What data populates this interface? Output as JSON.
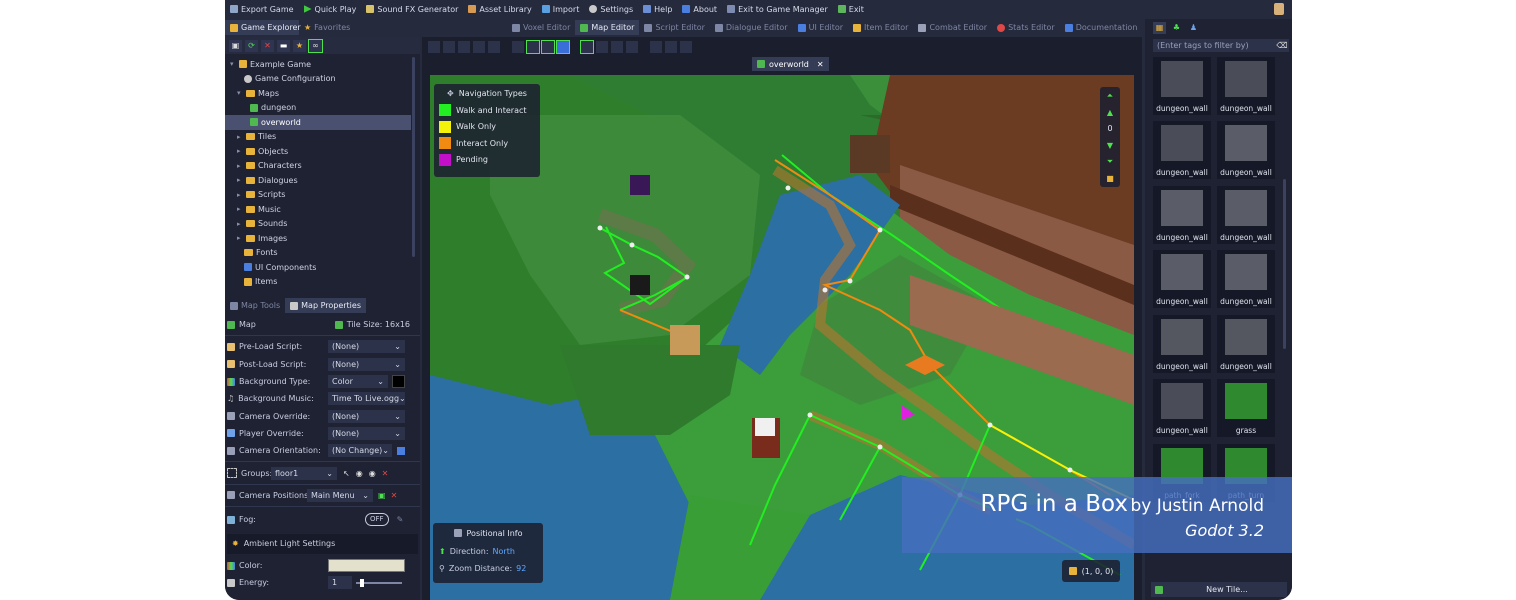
{
  "menu": [
    {
      "label": "Export Game",
      "icon": "export-icon"
    },
    {
      "label": "Quick Play",
      "icon": "play-icon"
    },
    {
      "label": "Sound FX Generator",
      "icon": "sound-icon"
    },
    {
      "label": "Asset Library",
      "icon": "library-icon"
    },
    {
      "label": "Import",
      "icon": "import-icon"
    },
    {
      "label": "Settings",
      "icon": "gear-icon"
    },
    {
      "label": "Help",
      "icon": "help-icon"
    },
    {
      "label": "About",
      "icon": "info-icon"
    },
    {
      "label": "Exit to Game Manager",
      "icon": "exit-icon"
    },
    {
      "label": "Exit",
      "icon": "exit-icon"
    }
  ],
  "left_tabs": {
    "explorer": "Game Explorer",
    "favorites": "Favorites"
  },
  "editor_tabs": [
    "Voxel Editor",
    "Map Editor",
    "Script Editor",
    "Dialogue Editor",
    "UI Editor",
    "Item Editor",
    "Combat Editor",
    "Stats Editor",
    "Documentation"
  ],
  "active_editor_tab": "Map Editor",
  "tree": {
    "root": "Example Game",
    "config": "Game Configuration",
    "maps": "Maps",
    "map1": "dungeon",
    "map2": "overworld",
    "folders": [
      "Tiles",
      "Objects",
      "Characters",
      "Dialogues",
      "Scripts",
      "Music",
      "Sounds",
      "Images",
      "Fonts"
    ],
    "ui": "UI Components",
    "items": "Items"
  },
  "props_tabs": {
    "tools": "Map Tools",
    "props": "Map Properties"
  },
  "props": {
    "map": "Map",
    "tile_size": "Tile Size: 16x16",
    "rows": [
      {
        "label": "Pre-Load Script:",
        "value": "(None)"
      },
      {
        "label": "Post-Load Script:",
        "value": "(None)"
      },
      {
        "label": "Background Type:",
        "value": "Color"
      },
      {
        "label": "Background Music:",
        "value": "Time To Live.ogg"
      },
      {
        "label": "Camera Override:",
        "value": "(None)"
      },
      {
        "label": "Player Override:",
        "value": "(None)"
      },
      {
        "label": "Camera Orientation:",
        "value": "(No Change)"
      }
    ],
    "groups_label": "Groups:",
    "groups_value": "floor1",
    "campos_label": "Camera Positions:",
    "campos_value": "Main Menu",
    "fog_label": "Fog:",
    "fog_toggle": "OFF",
    "ambient": "Ambient Light Settings",
    "color_label": "Color:",
    "energy_label": "Energy:",
    "energy_value": "1"
  },
  "viewport": {
    "map_tab": "overworld",
    "nav_title": "Navigation Types",
    "legend": [
      {
        "label": "Walk and Interact",
        "color": "#22ee22"
      },
      {
        "label": "Walk Only",
        "color": "#f2f20a"
      },
      {
        "label": "Interact Only",
        "color": "#f08a10"
      },
      {
        "label": "Pending",
        "color": "#c40fc8"
      }
    ],
    "layer_value": "0",
    "pos_title": "Positional Info",
    "direction_label": "Direction:",
    "direction_value": "North",
    "zoom_label": "Zoom Distance:",
    "zoom_value": "92",
    "coords": "(1, 0, 0)"
  },
  "right": {
    "filter_placeholder": "(Enter tags to filter by)",
    "tiles": [
      {
        "label": "dungeon_wall"
      },
      {
        "label": "dungeon_wall"
      },
      {
        "label": "dungeon_wall"
      },
      {
        "label": "dungeon_wall"
      },
      {
        "label": "dungeon_wall"
      },
      {
        "label": "dungeon_wall"
      },
      {
        "label": "dungeon_wall"
      },
      {
        "label": "dungeon_wall"
      },
      {
        "label": "dungeon_wall"
      },
      {
        "label": "dungeon_wall"
      },
      {
        "label": "dungeon_wall"
      },
      {
        "label": "grass"
      },
      {
        "label": "path_fork"
      },
      {
        "label": "path_turn"
      }
    ],
    "new_tile": "New Tile..."
  },
  "watermark": {
    "title": "RPG in a Box",
    "by": "by Justin Arnold",
    "engine": "Godot 3.2"
  },
  "colors": {
    "bg": "#252a3d",
    "panel": "#1e2233",
    "accent": "#4fe04f",
    "selection": "#4a5070"
  }
}
